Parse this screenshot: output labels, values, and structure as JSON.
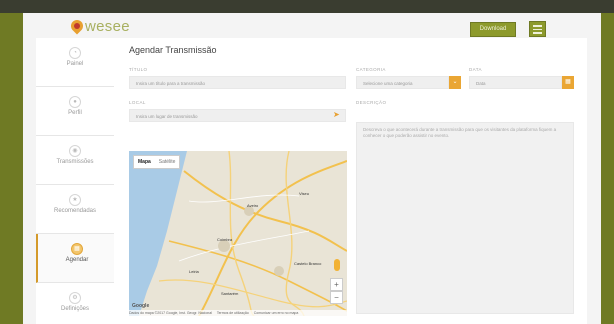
{
  "header": {
    "logo_text": "wesee",
    "download_label": "Download",
    "menu_icon": "hamburger-icon"
  },
  "sidebar": {
    "items": [
      {
        "label": "Painel",
        "icon": "dashboard-icon"
      },
      {
        "label": "Perfil",
        "icon": "user-icon"
      },
      {
        "label": "Transmissões",
        "icon": "broadcast-icon"
      },
      {
        "label": "Recomendadas",
        "icon": "star-icon"
      },
      {
        "label": "Agendar",
        "icon": "calendar-icon",
        "active": true
      },
      {
        "label": "Definições",
        "icon": "settings-icon"
      }
    ]
  },
  "form": {
    "title": "Agendar Transmissão",
    "titulo_label": "TÍTULO",
    "titulo_placeholder": "Insira um título para a transmissão",
    "categoria_label": "CATEGORIA",
    "categoria_value": "Selecione uma categoria",
    "data_label": "DATA",
    "data_value": "Data",
    "local_label": "LOCAL",
    "local_placeholder": "Insira um lugar de transmissão",
    "descricao_label": "DESCRIÇÃO",
    "descricao_placeholder": "Descreva o que acontecerá durante a transmissão para que os visitantes da plataforma fiquem a conhecer o que poderão assistir no evento."
  },
  "map": {
    "tab_map": "Mapa",
    "tab_satellite": "Satélite",
    "zoom_in": "+",
    "zoom_out": "−",
    "google": "Google",
    "footer": [
      "Dados do mapa ©2017 Google, Inst. Geogr. Nacional",
      "Termos de utilização",
      "Comunicar um erro no mapa"
    ],
    "places": [
      "Aveiro",
      "Viseu",
      "Coimbra",
      "Leiria",
      "Castelo Branco",
      "Santarém"
    ],
    "colors": {
      "sea": "#a9cbe6",
      "land": "#e9e4d6",
      "roads": "#f2c14e"
    }
  },
  "colors": {
    "accent": "#8d9a2c",
    "orange": "#eaa634",
    "background": "#6f7a24"
  }
}
